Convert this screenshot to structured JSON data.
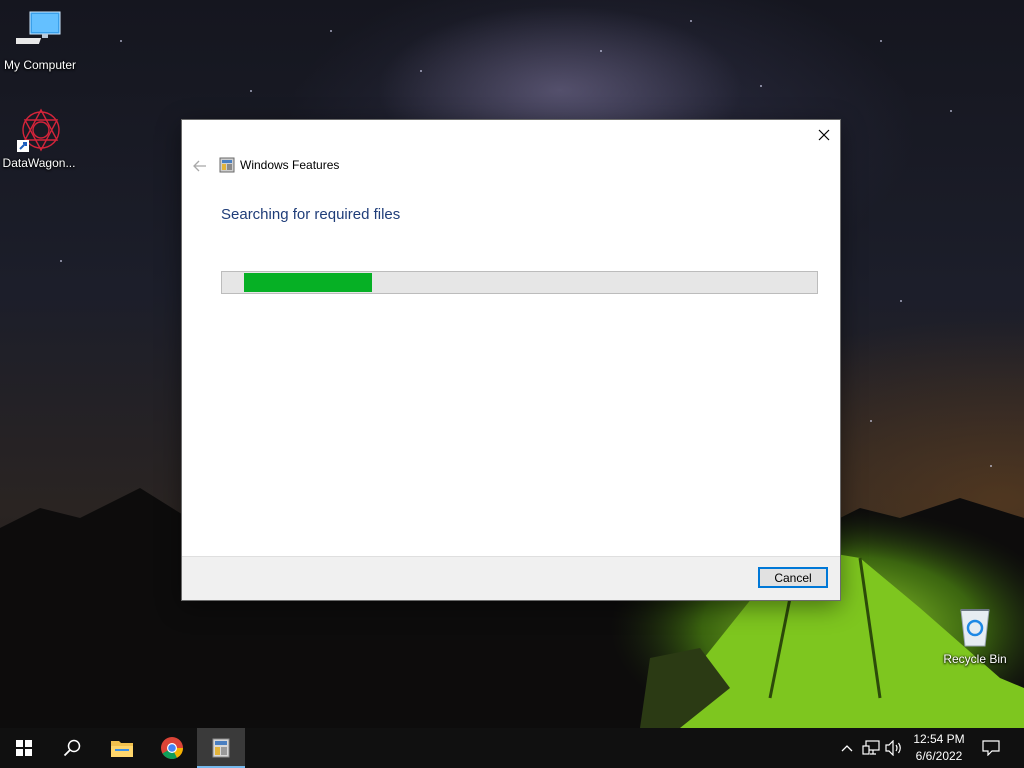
{
  "desktop": {
    "icons": [
      {
        "label": "My Computer",
        "icon": "computer-icon"
      },
      {
        "label": "DataWagon...",
        "icon": "datawagon-shortcut-icon"
      },
      {
        "label": "Recycle Bin",
        "icon": "recycle-bin-icon"
      }
    ]
  },
  "dialog": {
    "title": "Windows Features",
    "heading": "Searching for required files",
    "progress": 0.215,
    "cancel_label": "Cancel",
    "accent_color": "#06b025"
  },
  "taskbar": {
    "apps": [
      "start-icon",
      "search-icon",
      "file-explorer-icon",
      "chrome-icon",
      "windows-features-icon"
    ],
    "clock": {
      "time": "12:54 PM",
      "date": "6/6/2022"
    }
  }
}
